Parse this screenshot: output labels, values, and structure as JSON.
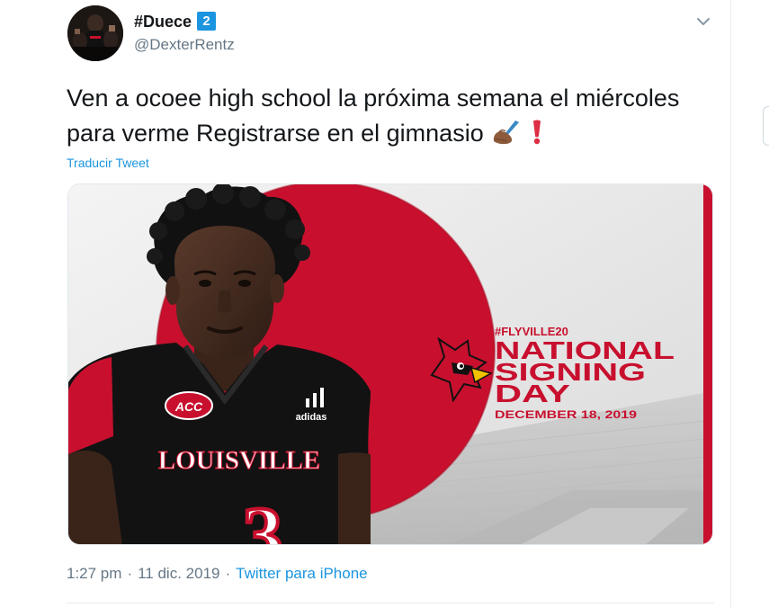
{
  "user": {
    "display_name": "#Duece",
    "badge": "2",
    "handle": "@DexterRentz"
  },
  "tweet": {
    "text": "Ven a ocoee high school la próxima semana el miércoles para verme Registrarse en el gimnasio",
    "emojis": [
      "writing-hand-icon",
      "exclamation-icon"
    ],
    "translate_label": "Traducir Tweet"
  },
  "media": {
    "hashtag": "#FLYVILLE20",
    "line1": "NATIONAL",
    "line2": "SIGNING",
    "line3": "DAY",
    "date": "DECEMBER 18, 2019",
    "jersey_text": "LOUISVILLE",
    "jersey_number": "3",
    "patch_text": "ACC",
    "brand_text": "adidas"
  },
  "meta": {
    "time": "1:27 pm",
    "date": "11 dic. 2019",
    "separator": "·",
    "source": "Twitter para iPhone"
  },
  "colors": {
    "accent": "#1b95e0",
    "cardinal_red": "#c8102e",
    "text_primary": "#14171a",
    "text_secondary": "#657786"
  }
}
